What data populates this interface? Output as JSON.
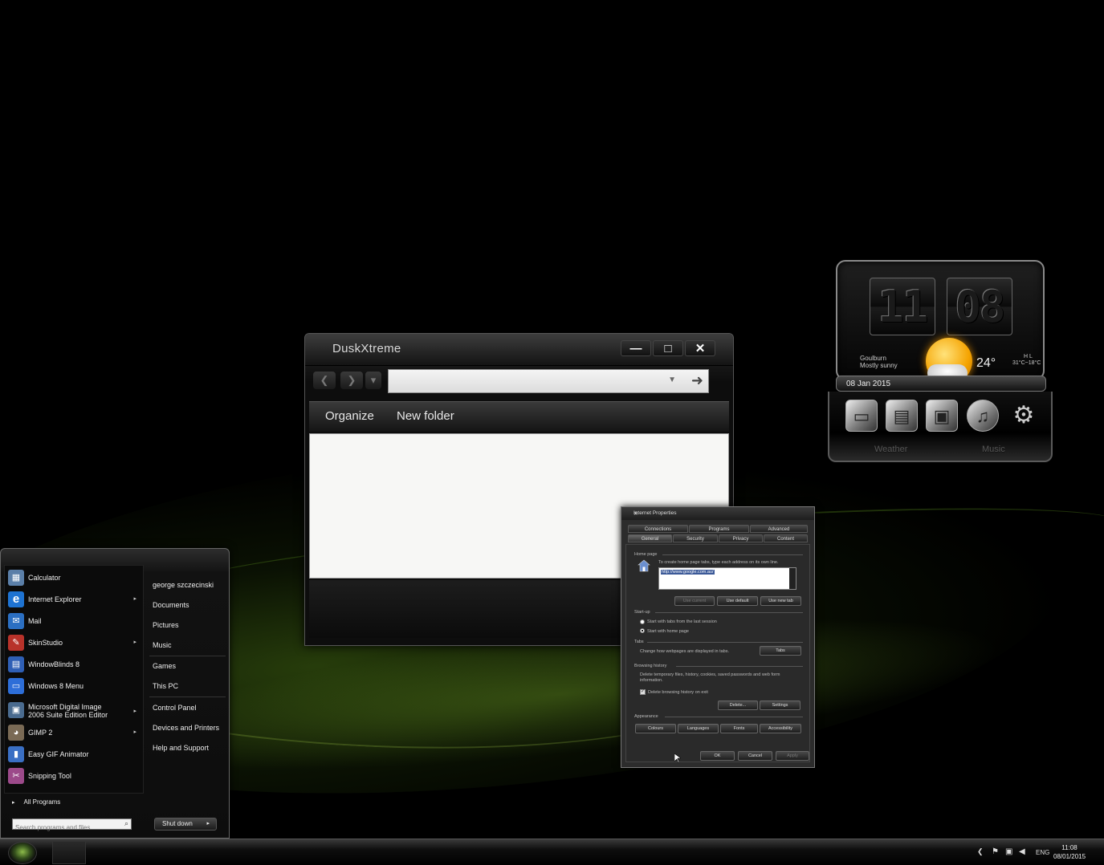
{
  "explorer": {
    "title": "DuskXtreme",
    "minimize": "—",
    "maximize": "□",
    "close": "✕",
    "back": "❮",
    "forward": "❯",
    "recent": "▾",
    "address_value": "",
    "address_dropdown": "▼",
    "go": "➜",
    "organize": "Organize",
    "new_folder": "New folder"
  },
  "internet_properties": {
    "title": "Internet Properties",
    "close": "✕",
    "tabs_row1": [
      "Connections",
      "Programs",
      "Advanced"
    ],
    "tabs_row2": [
      "General",
      "Security",
      "Privacy",
      "Content"
    ],
    "home_page_heading": "Home page",
    "home_page_hint": "To create home page tabs, type each address on its own line.",
    "home_page_url": "http://www.google.com.au/",
    "btn_use_current": "Use current",
    "btn_use_default": "Use default",
    "btn_use_new_tab": "Use new tab",
    "startup_heading": "Start-up",
    "startup_opt1": "Start with tabs from the last session",
    "startup_opt2": "Start with home page",
    "tabs_heading": "Tabs",
    "tabs_hint": "Change how webpages are displayed in tabs.",
    "btn_tabs": "Tabs",
    "history_heading": "Browsing history",
    "history_hint": "Delete temporary files, history, cookies, saved passwords and web form information.",
    "history_checkbox": "Delete browsing history on exit",
    "btn_delete": "Delete...",
    "btn_settings": "Settings",
    "appearance_heading": "Appearance",
    "btn_colours": "Colours",
    "btn_languages": "Languages",
    "btn_fonts": "Fonts",
    "btn_accessibility": "Accessibility",
    "btn_ok": "OK",
    "btn_cancel": "Cancel",
    "btn_apply": "Apply"
  },
  "gadget": {
    "hours": "11",
    "minutes": "08",
    "location": "Goulburn",
    "condition": "Mostly sunny",
    "temperature": "24°",
    "hl_labels": "H    L",
    "hl_values": "31°C~18°C",
    "date": "08 Jan 2015",
    "label_weather": "Weather",
    "label_music": "Music"
  },
  "start_menu": {
    "programs": [
      {
        "label": "Calculator",
        "icon": "calculator-icon",
        "glyph": "▦",
        "color": "#5b7fa8",
        "arrow": ""
      },
      {
        "label": "Internet Explorer",
        "icon": "internet-explorer-icon",
        "glyph": "e",
        "color": "#1e73d2",
        "arrow": "▸"
      },
      {
        "label": "Mail",
        "icon": "mail-icon",
        "glyph": "✉",
        "color": "#2b6fc2",
        "arrow": ""
      },
      {
        "label": "SkinStudio",
        "icon": "skinstudio-icon",
        "glyph": "✎",
        "color": "#b8322a",
        "arrow": "▸"
      },
      {
        "label": "WindowBlinds 8",
        "icon": "windowblinds-icon",
        "glyph": "▤",
        "color": "#2f5fb5",
        "arrow": ""
      },
      {
        "label": "Windows 8 Menu",
        "icon": "windows8-menu-icon",
        "glyph": "▭",
        "color": "#2d6ed8",
        "arrow": ""
      },
      {
        "label": "Microsoft Digital Image 2006 Suite Edition Editor",
        "icon": "digital-image-icon",
        "glyph": "▣",
        "color": "#4a6b8f",
        "arrow": "▸"
      },
      {
        "label": "GIMP 2",
        "icon": "gimp-icon",
        "glyph": "◕",
        "color": "#7a6a55",
        "arrow": "▸"
      },
      {
        "label": "Easy GIF Animator",
        "icon": "gif-animator-icon",
        "glyph": "▮",
        "color": "#3a6fc4",
        "arrow": ""
      },
      {
        "label": "Snipping Tool",
        "icon": "snipping-tool-icon",
        "glyph": "✂",
        "color": "#9c4a8a",
        "arrow": ""
      }
    ],
    "all_programs": "All Programs",
    "all_programs_arrow": "▸",
    "right": {
      "user": "george szczecinski",
      "documents": "Documents",
      "pictures": "Pictures",
      "music": "Music",
      "games": "Games",
      "this_pc": "This PC",
      "control_panel": "Control Panel",
      "devices": "Devices and Printers",
      "help": "Help and Support"
    },
    "search_placeholder": "Search programs and files",
    "shutdown": "Shut down",
    "shutdown_arrow": "▸"
  },
  "taskbar": {
    "tray_chevron": "❮",
    "language": "ENG",
    "time": "11:08",
    "date": "08/01/2015"
  }
}
